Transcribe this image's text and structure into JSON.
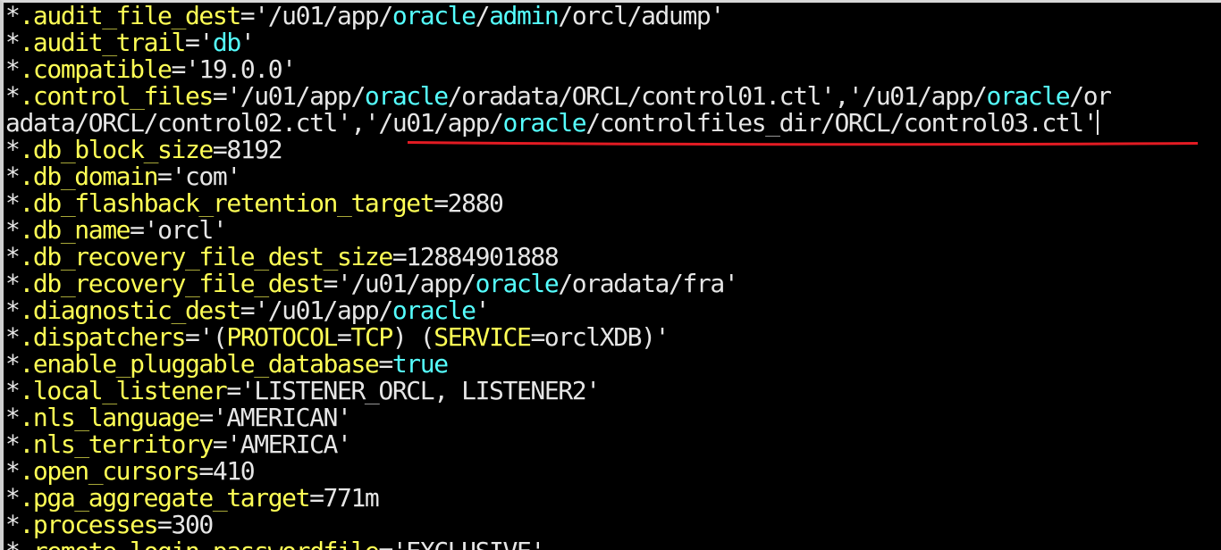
{
  "colors": {
    "background": "#000000",
    "text": "#e6e6e6",
    "parameter": "#ffff55",
    "keyword": "#55ffff",
    "annotation": "#e31b23"
  },
  "lines": [
    {
      "star": "*",
      "key": ".audit_file_dest",
      "eq": "=",
      "v1": "'/u01/app/",
      "k1": "oracle",
      "v2": "/",
      "k2": "admin",
      "v3": "/orcl/adump'"
    },
    {
      "star": "*",
      "key": ".audit_trail",
      "eq": "=",
      "v1": "'",
      "k1": "db",
      "v2": "'"
    },
    {
      "star": "*",
      "key": ".compatible",
      "eq": "=",
      "v1": "'19.0.0'"
    },
    {
      "star": "*",
      "key": ".control_files",
      "eq": "=",
      "v1": "'/u01/app/",
      "k1": "oracle",
      "v2": "/oradata/ORCL/control01.ctl','/u01/app/",
      "k2": "oracle",
      "v3": "/or"
    },
    {
      "v1": "adata/ORCL/control02.ctl',",
      "v2": "'/u01/app/",
      "k1": "oracle",
      "v3": "/controlfiles_dir/ORCL/control03.ctl'"
    },
    {
      "star": "*",
      "key": ".db_block_size",
      "eq": "=",
      "v1": "8192"
    },
    {
      "star": "*",
      "key": ".db_domain",
      "eq": "=",
      "v1": "'com'"
    },
    {
      "star": "*",
      "key": ".db_flashback_retention_target",
      "eq": "=",
      "v1": "2880"
    },
    {
      "star": "*",
      "key": ".db_name",
      "eq": "=",
      "v1": "'orcl'"
    },
    {
      "star": "*",
      "key": ".db_recovery_file_dest_size",
      "eq": "=",
      "v1": "12884901888"
    },
    {
      "star": "*",
      "key": ".db_recovery_file_dest",
      "eq": "=",
      "v1": "'/u01/app/",
      "k1": "oracle",
      "v2": "/oradata/fra'"
    },
    {
      "star": "*",
      "key": ".diagnostic_dest",
      "eq": "=",
      "v1": "'/u01/app/",
      "k1": "oracle",
      "v2": "'"
    },
    {
      "star": "*",
      "key": ".dispatchers",
      "eq": "=",
      "v1": "'(",
      "y1": "PROTOCOL",
      "v2": "=",
      "y2": "TCP",
      "v3": ") (",
      "y3": "SERVICE",
      "v4": "=orclXDB)'"
    },
    {
      "star": "*",
      "key": ".enable_pluggable_database",
      "eq": "=",
      "k1": "true"
    },
    {
      "star": "*",
      "key": ".local_listener",
      "eq": "=",
      "v1": "'LISTENER_ORCL, LISTENER2'"
    },
    {
      "star": "*",
      "key": ".nls_language",
      "eq": "=",
      "v1": "'AMERICAN'"
    },
    {
      "star": "*",
      "key": ".nls_territory",
      "eq": "=",
      "v1": "'AMERICA'"
    },
    {
      "star": "*",
      "key": ".open_cursors",
      "eq": "=",
      "v1": "410"
    },
    {
      "star": "*",
      "key": ".pga_aggregate_target",
      "eq": "=",
      "v1": "771m"
    },
    {
      "star": "*",
      "key": ".processes",
      "eq": "=",
      "v1": "300"
    },
    {
      "star": "*",
      "key": ".remote_login_passwordfile",
      "eq": "=",
      "v1": "'EXCLUSIVE'"
    }
  ]
}
